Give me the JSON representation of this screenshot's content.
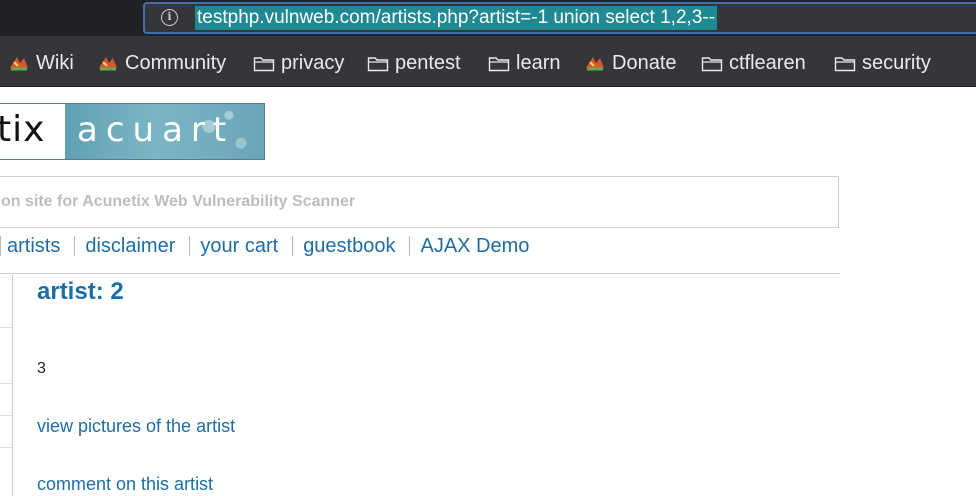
{
  "browser": {
    "url": "testphp.vulnweb.com/artists.php?artist=-1 union select 1,2,3--",
    "bookmarks": [
      {
        "label": "Wiki",
        "icon": "site-favicon"
      },
      {
        "label": "Community",
        "icon": "site-favicon"
      },
      {
        "label": "privacy",
        "icon": "folder-icon"
      },
      {
        "label": "pentest",
        "icon": "folder-icon"
      },
      {
        "label": "learn",
        "icon": "folder-icon"
      },
      {
        "label": "Donate",
        "icon": "site-favicon"
      },
      {
        "label": "ctflearen",
        "icon": "folder-icon"
      },
      {
        "label": "security",
        "icon": "folder-icon"
      }
    ]
  },
  "site": {
    "logo_left": "tix",
    "logo_right": "acuart",
    "tagline": "on site for Acunetix Web Vulnerability Scanner",
    "nav": [
      "artists",
      "disclaimer",
      "your cart",
      "guestbook",
      "AJAX Demo"
    ]
  },
  "content": {
    "title": "artist: 2",
    "value": "3",
    "link_pictures": "view pictures of the artist",
    "link_comment": "comment on this artist"
  },
  "colors": {
    "link": "#1c6ea4",
    "chrome_bg": "#35363a",
    "url_selection": "#1f8a93",
    "tagline": "#bdbdbd"
  }
}
